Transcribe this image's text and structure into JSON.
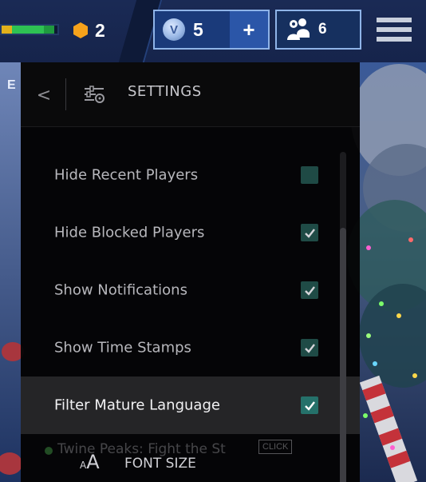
{
  "topbar": {
    "level": "2",
    "vbucks": "5",
    "vbucks_coin_symbol": "V",
    "add_vbucks_label": "+",
    "party_count": "6",
    "xp_bar_fill_fraction": 0.95
  },
  "left_strip": {
    "letter": "E"
  },
  "panel": {
    "back_label": "<",
    "title": "SETTINGS",
    "settings": [
      {
        "label": "Hide Recent Players",
        "checked": false,
        "highlighted": false
      },
      {
        "label": "Hide Blocked Players",
        "checked": true,
        "highlighted": false
      },
      {
        "label": "Show Notifications",
        "checked": true,
        "highlighted": false
      },
      {
        "label": "Show Time Stamps",
        "checked": true,
        "highlighted": false
      },
      {
        "label": "Filter Mature Language",
        "checked": true,
        "highlighted": true
      }
    ],
    "chat_ghost_text": "Twine Peaks: Fight the St",
    "chat_ghost_badge": "CLICK",
    "font_size_icon_small": "A",
    "font_size_icon_big": "A",
    "font_size_label": "FONT SIZE"
  },
  "colors": {
    "topbar_bg": "#1a2a55",
    "vbucks_border": "#8fb4e8",
    "level_hex": "#f7a21b",
    "panel_bg": "#050506",
    "checkbox": "#1f4b46",
    "checkbox_highlighted": "#25716a",
    "highlight_row": "#252527",
    "xp_fill_colors": [
      "#e2b11b",
      "#2ec253",
      "#2ec253",
      "#2ec253",
      "#1f9a3f"
    ]
  },
  "icons": {
    "level": "hexagon-icon",
    "vbucks": "vbucks-coin-icon",
    "party": "friends-icon",
    "menu": "hamburger-menu-icon",
    "back": "chevron-left-icon",
    "settings": "settings-sliders-icon",
    "check": "checkmark-icon",
    "font_size": "font-size-icon"
  }
}
